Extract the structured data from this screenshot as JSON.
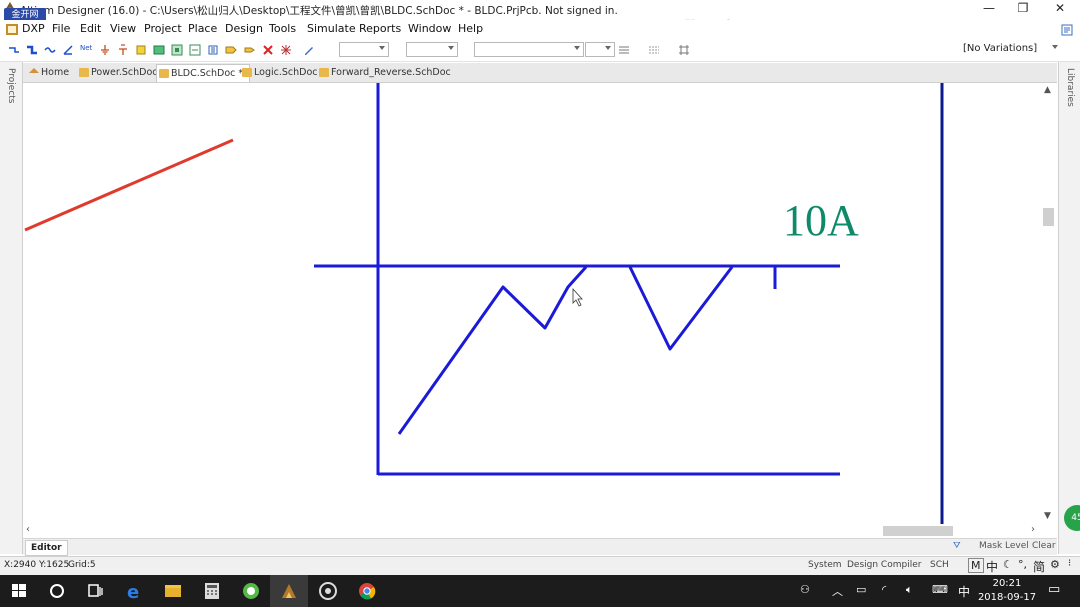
{
  "window": {
    "title": "Altium Designer (16.0) - C:\\Users\\松山归人\\Desktop\\工程文件\\曾凯\\曾凯\\BLDC.SchDoc * - BLDC.PrjPcb. Not signed in.",
    "watermark_badge": "金开网",
    "watermark_text": "张飞官网：www.zhangfeidz.com",
    "minimize": "—",
    "restore": "❐",
    "close": "✕"
  },
  "menu": [
    "DXP",
    "File",
    "Edit",
    "View",
    "Project",
    "Place",
    "Design",
    "Tools",
    "Simulate",
    "Reports",
    "Window",
    "Help"
  ],
  "toolbar": {
    "variations": "[No Variations]",
    "net_label": "Net"
  },
  "panels": {
    "left": "Projects",
    "right": "Libraries"
  },
  "tabs": [
    {
      "label": "Home"
    },
    {
      "label": "Power.SchDoc"
    },
    {
      "label": "BLDC.SchDoc *"
    },
    {
      "label": "Logic.SchDoc"
    },
    {
      "label": "Forward_Reverse.SchDoc"
    }
  ],
  "canvas": {
    "annotation": "10A",
    "colors": {
      "wire": "#1a1ad8",
      "annotation": "#0e8a6a",
      "red_line": "#e03a2e",
      "frame_right": "#0b1a8e"
    }
  },
  "editor": {
    "tab": "Editor",
    "mask_level": "Mask Level",
    "clear": "Clear"
  },
  "status": {
    "coords": "X:2940 Y:1625",
    "grid": "Grid:5",
    "buttons": [
      "System",
      "Design Compiler",
      "SCH"
    ]
  },
  "taskbar": {
    "time": "20:21",
    "date": "2018-09-17",
    "ime_lang": "中",
    "ime_mode": "简",
    "ime_M": "M",
    "badge": "45"
  }
}
